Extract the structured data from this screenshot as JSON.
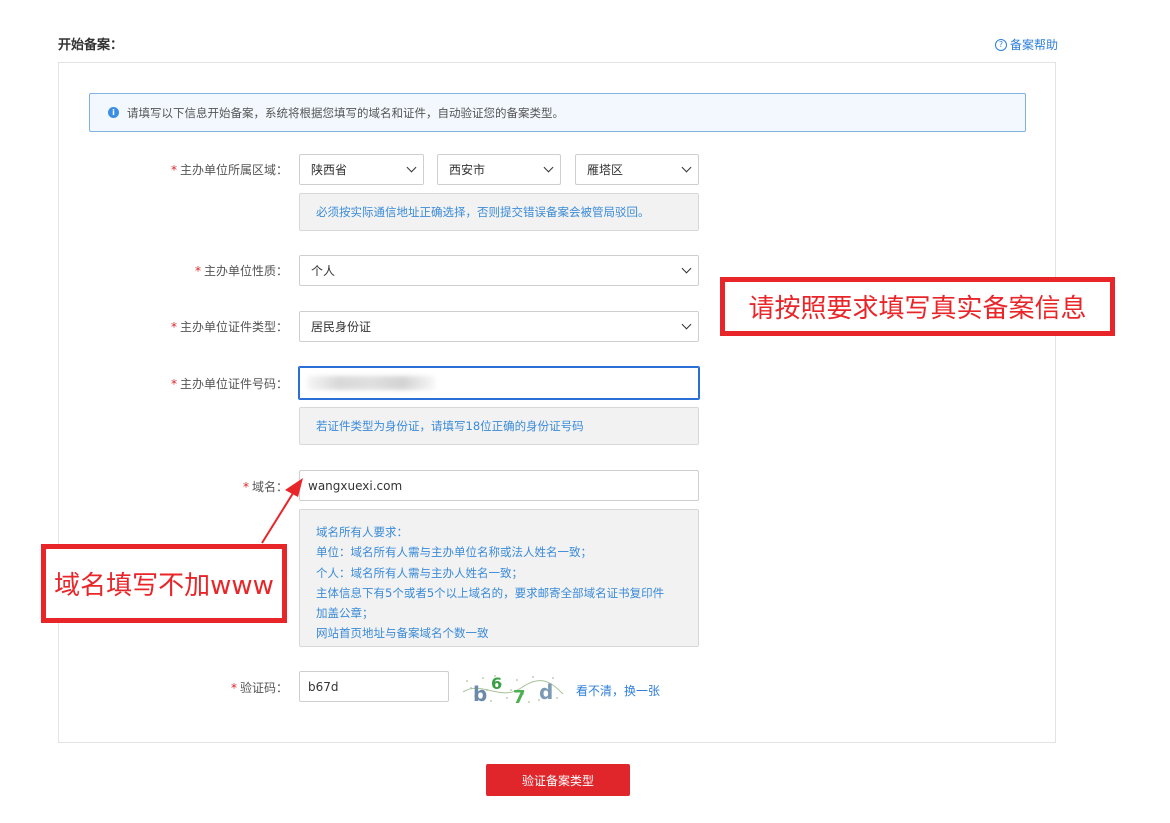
{
  "page": {
    "title": "开始备案：",
    "help_link": "备案帮助"
  },
  "notice": {
    "text": "请填写以下信息开始备案，系统将根据您填写的域名和证件，自动验证您的备案类型。"
  },
  "form": {
    "region": {
      "label": "主办单位所属区域：",
      "province": "陕西省",
      "city": "西安市",
      "district": "雁塔区",
      "tip": "必须按实际通信地址正确选择，否则提交错误备案会被管局驳回。"
    },
    "unit_type": {
      "label": "主办单位性质：",
      "value": "个人"
    },
    "cert_type": {
      "label": "主办单位证件类型：",
      "value": "居民身份证"
    },
    "cert_number": {
      "label": "主办单位证件号码：",
      "tip": "若证件类型为身份证，请填写18位正确的身份证号码"
    },
    "domain": {
      "label": "域名：",
      "value": "wangxuexi.com",
      "tips": [
        "域名所有人要求：",
        "单位：域名所有人需与主办单位名称或法人姓名一致；",
        "个人：域名所有人需与主办人姓名一致；",
        "主体信息下有5个或者5个以上域名的，要求邮寄全部域名证书复印件",
        "加盖公章；",
        "网站首页地址与备案域名个数一致"
      ]
    },
    "captcha": {
      "label": "验证码：",
      "value": "b67d",
      "refresh_link": "看不清，换一张",
      "image_text": [
        "b",
        "6",
        "7",
        "d"
      ]
    },
    "required_mark": "*"
  },
  "submit_label": "验证备案类型",
  "annotations": {
    "right": "请按照要求填写真实备案信息",
    "left": "域名填写不加www"
  },
  "colors": {
    "accent_red": "#e0252b",
    "link_blue": "#2f7fd8",
    "tip_blue": "#3b8bd8",
    "focus_blue": "#2a6fd6",
    "annotation_red": "#e8262a"
  }
}
